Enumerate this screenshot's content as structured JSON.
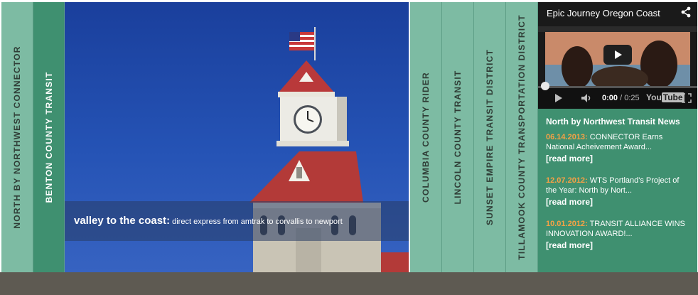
{
  "tabs_left": [
    {
      "label": "NORTH BY NORTHWEST CONNECTOR"
    },
    {
      "label": "BENTON COUNTY TRANSIT"
    }
  ],
  "tabs_right": [
    {
      "label": "COLUMBIA COUNTY RIDER"
    },
    {
      "label": "LINCOLN COUNTY TRANSIT"
    },
    {
      "label": "SUNSET EMPIRE TRANSIT DISTRICT"
    },
    {
      "label": "TILLAMOOK COUNTY TRANSPORTATION DISTRICT"
    }
  ],
  "hero": {
    "caption_bold": "valley to the coast",
    "caption_sep": ":",
    "caption_text": " direct express from amtrak to corvallis to newport"
  },
  "video": {
    "title": "Epic Journey Oregon Coast",
    "time_current": "0:00",
    "time_sep": " / ",
    "time_total": "0:25",
    "brand_you": "You",
    "brand_tube": "Tube",
    "share_icon": "share-icon",
    "play_icon": "play-icon",
    "volume_icon": "volume-icon",
    "fullscreen_icon": "fullscreen-icon",
    "progress": 0
  },
  "news": {
    "title": "North by Northwest Transit News",
    "items": [
      {
        "date": "06.14.2013",
        "sep": ":",
        "text": " CONNECTOR Earns National Acheivement Award...",
        "more": "[read more]"
      },
      {
        "date": "12.07.2012",
        "sep": ":",
        "text": " WTS Portland's Project of the Year: North by Nort...",
        "more": "[read more]"
      },
      {
        "date": "10.01.2012",
        "sep": ":",
        "text": " TRANSIT ALLIANCE WINS INNOVATION AWARD!...",
        "more": "[read more]"
      }
    ]
  },
  "colors": {
    "tab": "#7dbba3",
    "tab_active": "#3f9070",
    "panel": "#3f9070",
    "date": "#f7a145",
    "bottom_bar": "#5e5a52"
  }
}
